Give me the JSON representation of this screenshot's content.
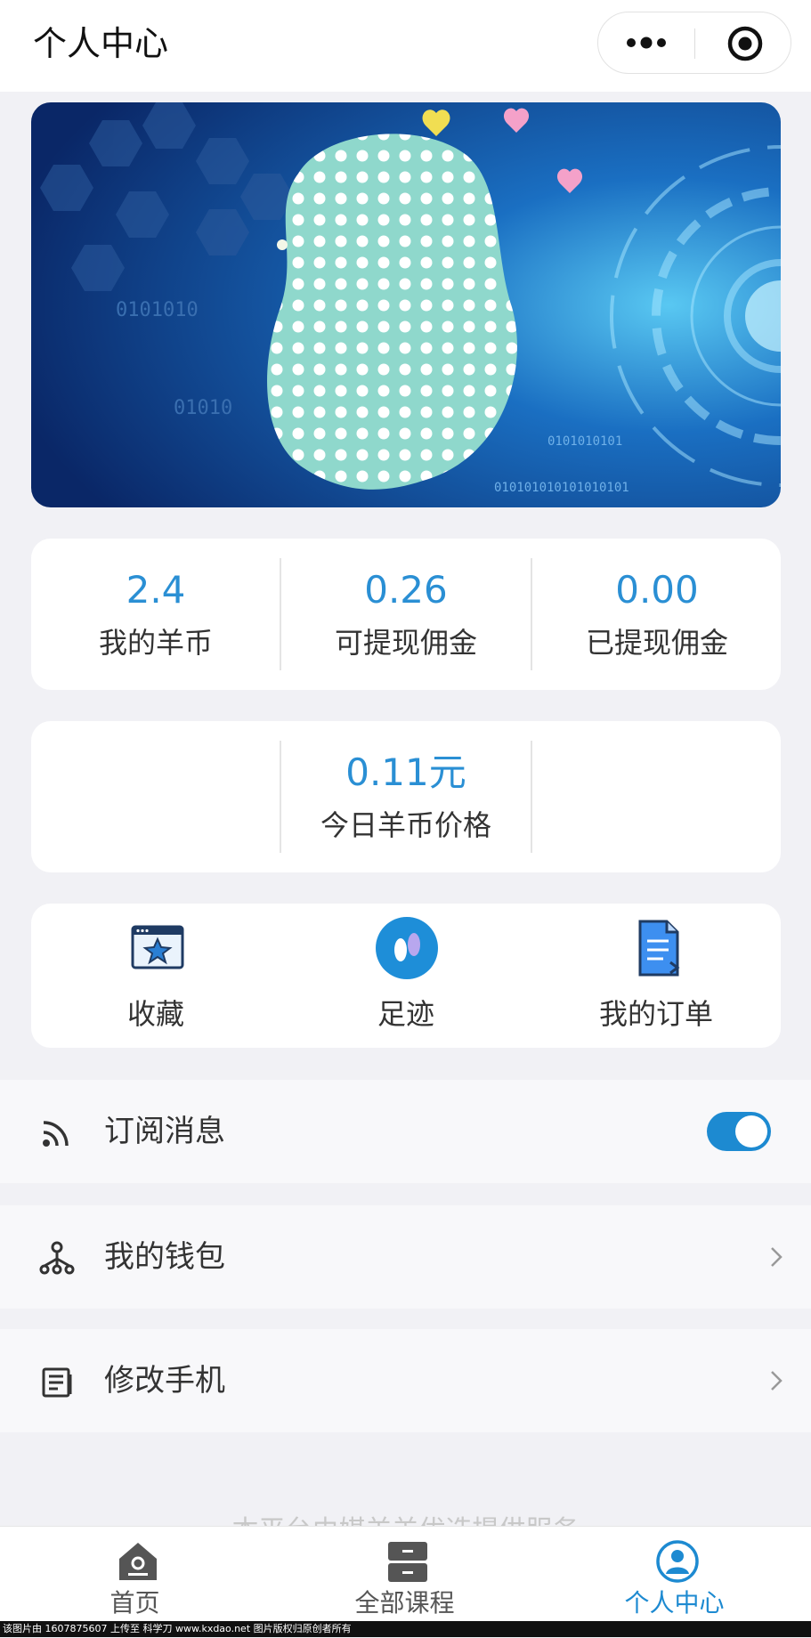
{
  "header": {
    "title": "个人中心"
  },
  "capsule": {
    "more_icon": "more-dots-icon",
    "target_icon": "target-circle-icon"
  },
  "banner": {
    "digits": [
      "0101010",
      "01010",
      "0101010101",
      "010101010101010101"
    ]
  },
  "wallet_stats": [
    {
      "value": "2.4",
      "label": "我的羊币"
    },
    {
      "value": "0.26",
      "label": "可提现佣金"
    },
    {
      "value": "0.00",
      "label": "已提现佣金"
    }
  ],
  "price": {
    "value": "0.11元",
    "label": "今日羊币价格"
  },
  "shortcuts": [
    {
      "label": "收藏",
      "icon": "favorite-window-icon"
    },
    {
      "label": "足迹",
      "icon": "footprint-icon"
    },
    {
      "label": "我的订单",
      "icon": "order-document-icon"
    }
  ],
  "menu": {
    "subscribe": {
      "label": "订阅消息",
      "icon": "rss-icon",
      "enabled": true
    },
    "wallet": {
      "label": "我的钱包",
      "icon": "network-icon"
    },
    "phone": {
      "label": "修改手机",
      "icon": "edit-list-icon"
    }
  },
  "ghost_text": "本平台由媒羊羊优选提供服务",
  "tabs": [
    {
      "label": "首页",
      "icon": "home-icon",
      "active": false
    },
    {
      "label": "全部课程",
      "icon": "courses-drawer-icon",
      "active": false
    },
    {
      "label": "个人中心",
      "icon": "profile-icon",
      "active": true
    }
  ],
  "colors": {
    "accent": "#1d8ad1",
    "stat_value": "#2a8fd4",
    "background": "#f1f1f5"
  },
  "footer_watermark": "该图片由 1607875607 上传至 科学刀 www.kxdao.net 图片版权归原创者所有"
}
